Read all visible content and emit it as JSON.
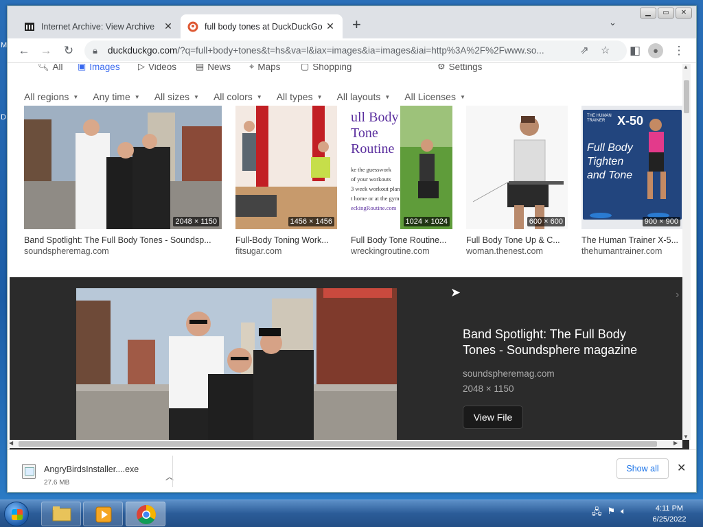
{
  "browser": {
    "tabs": [
      {
        "title": "Internet Archive: View Archive",
        "close": "✕",
        "active": false
      },
      {
        "title": "full body tones at DuckDuckGo",
        "close": "✕",
        "active": true
      }
    ],
    "new_tab": "+",
    "url_host": "duckduckgo.com",
    "url_rest": "/?q=full+body+tones&t=hs&va=l&iax=images&ia=images&iai=http%3A%2F%2Fwww.so..."
  },
  "search_nav": {
    "tabs": [
      "All",
      "Images",
      "Videos",
      "News",
      "Maps",
      "Shopping"
    ],
    "active": "Images",
    "settings": "Settings"
  },
  "filters": [
    "All regions",
    "Any time",
    "All sizes",
    "All colors",
    "All types",
    "All layouts",
    "All Licenses"
  ],
  "results": [
    {
      "title": "Band Spotlight: The Full Body Tones - Soundsp...",
      "source": "soundspheremag.com",
      "dims": "2048 × 1150"
    },
    {
      "title": "Full-Body Toning Work...",
      "source": "fitsugar.com",
      "dims": "1456 × 1456"
    },
    {
      "title": "Full Body Tone Routine...",
      "source": "wreckingroutine.com",
      "dims": "1024 × 1024"
    },
    {
      "title": "Full Body Tone Up & C...",
      "source": "woman.thenest.com",
      "dims": "600 × 600"
    },
    {
      "title": "The Human Trainer X-5...",
      "source": "thehumantrainer.com",
      "dims": "900 × 900"
    }
  ],
  "thumb_text": {
    "routine": [
      "ull Body",
      "Tone",
      "Routine"
    ],
    "routine_small": [
      "ke the guesswork",
      "of your workouts",
      "3 week workout plan",
      "t home or at the gym",
      "eckingRoutine.com"
    ],
    "trainer_brand": "THE HUMAN TRAINER",
    "trainer_model": "X-50",
    "trainer_lines": [
      "Full Body",
      "Tighten",
      "and Tone"
    ]
  },
  "detail": {
    "title": "Band Spotlight: The Full Body Tones - Soundsphere magazine",
    "source": "soundspheremag.com",
    "dims": "2048 × 1150",
    "button": "View File"
  },
  "download": {
    "filename": "AngryBirdsInstaller....exe",
    "size": "27.6 MB",
    "show_all": "Show all"
  },
  "taskbar": {
    "time": "4:11 PM",
    "date": "6/25/2022"
  },
  "colors": {
    "accent": "#3969ef",
    "detail_bg": "#2b2b2b",
    "taskbar": "#2b5c98"
  }
}
